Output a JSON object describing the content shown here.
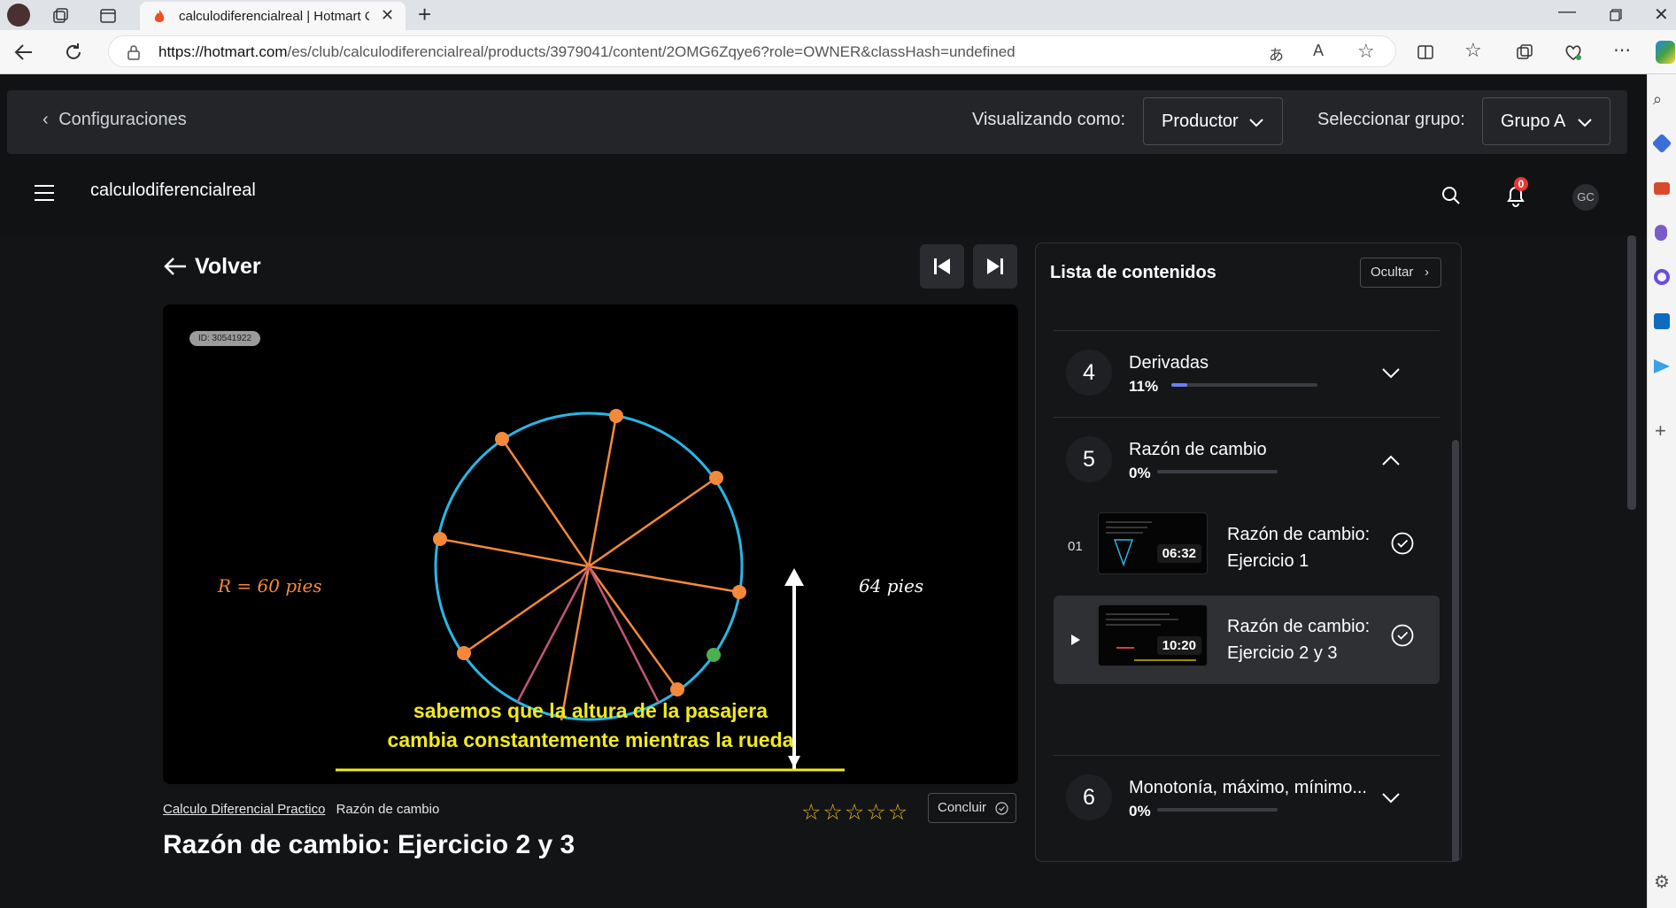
{
  "browser": {
    "tab_title": "calculodiferencialreal | Hotmart C",
    "url_host": "https://hotmart.com",
    "url_path": "/es/club/calculodiferencialreal/products/3979041/content/2OMG6Zqye6?role=OWNER&classHash=undefined"
  },
  "config_bar": {
    "back_label": "Configuraciones",
    "viewing_as_label": "Visualizando como:",
    "viewing_as_value": "Productor",
    "group_label": "Seleccionar grupo:",
    "group_value": "Grupo A"
  },
  "header": {
    "brand": "calculodiferencialreal",
    "notification_count": "0",
    "avatar_initials": "GC"
  },
  "player": {
    "back_label": "Volver",
    "video_id": "ID: 30541922",
    "radius_label": "R = 60 pies",
    "height_label": "64 pies",
    "subtitle_line1": "sabemos que la altura de la pasajera",
    "subtitle_line2": "cambia constantemente mientras la rueda"
  },
  "lesson": {
    "course_link": "Calculo Diferencial Practico",
    "module": "Razón de cambio",
    "conclude_label": "Concluir",
    "title": "Razón de cambio: Ejercicio 2 y 3",
    "rating_stars": 0,
    "rating_max": 5
  },
  "contents": {
    "title": "Lista de contenidos",
    "hide_label": "Ocultar",
    "modules": [
      {
        "number": "4",
        "name": "Derivadas",
        "progress_label": "11%",
        "progress": 0.11,
        "expanded": false
      },
      {
        "number": "5",
        "name": "Razón de cambio",
        "progress_label": "0%",
        "progress": 0.0,
        "expanded": true
      },
      {
        "number": "6",
        "name": "Monotonía, máximo, mínimo...",
        "progress_label": "0%",
        "progress": 0.0,
        "expanded": false
      }
    ],
    "lessons": [
      {
        "index": "01",
        "name": "Razón de cambio: Ejercicio 1",
        "duration": "06:32",
        "completed": true,
        "active": false
      },
      {
        "index": "",
        "name": "Razón de cambio: Ejercicio 2 y 3",
        "duration": "10:20",
        "completed": true,
        "active": true
      }
    ]
  },
  "colors": {
    "accent": "#6d7ef2",
    "star": "#e8b61d",
    "subtitle": "#f2ea1c",
    "notification_badge": "#e53935",
    "circle": "#29b6e6",
    "spoke": "#f5893a"
  }
}
